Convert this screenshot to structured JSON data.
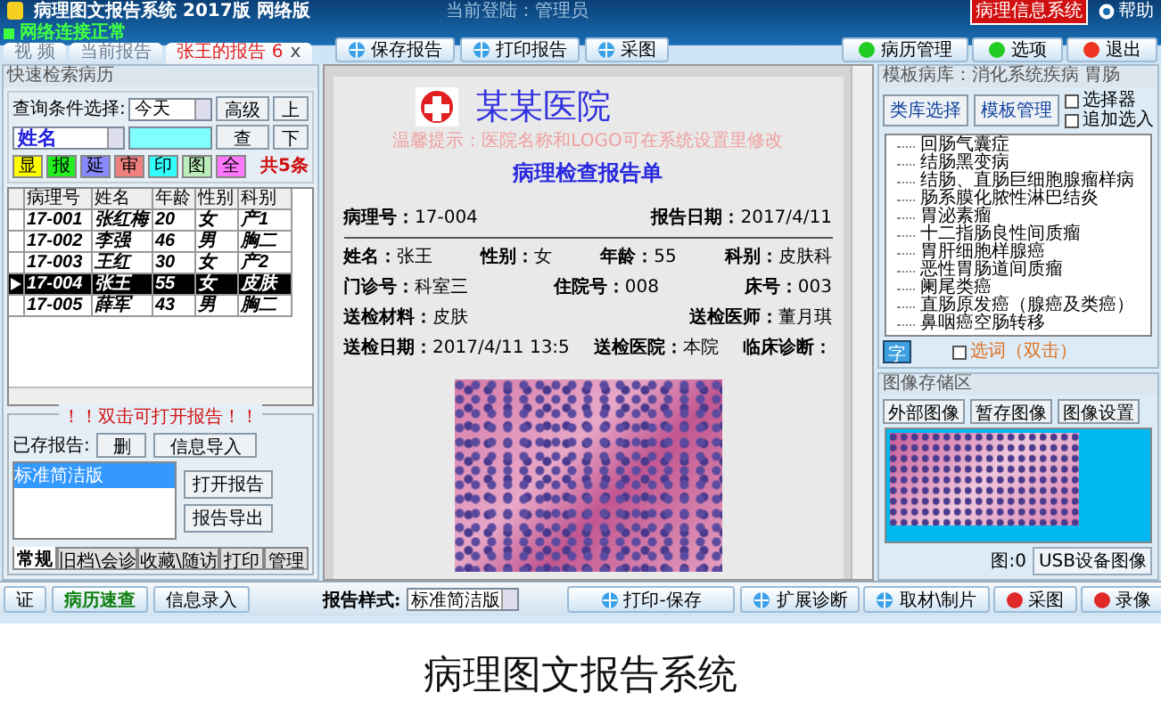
{
  "title_bar": {
    "title": "病理图文报告系统 2017版 网络版",
    "login": "当前登陆：管理员",
    "badge": "病理信息系统",
    "help": "帮助"
  },
  "connection": "网络连接正常",
  "report_tabs": [
    {
      "label": "视 频",
      "selected": false
    },
    {
      "label": "当前报告",
      "selected": false
    },
    {
      "label": "张王的报告 6",
      "selected": true,
      "close": "x"
    }
  ],
  "toolbar": [
    "保存报告",
    "打印报告",
    "采图"
  ],
  "nav_buttons": [
    {
      "label": "病历管理",
      "color": "#22cc22"
    },
    {
      "label": "选项",
      "color": "#22cc22"
    },
    {
      "label": "退出",
      "color": "#ee3322"
    }
  ],
  "search_panel": {
    "title": "快速检索病历",
    "query_label": "查询条件选择:",
    "query_value": "今天",
    "buttons": [
      "高级",
      "上",
      "查",
      "下"
    ],
    "field_select": "姓名",
    "filters": [
      {
        "label": "显",
        "color": "#ffff00"
      },
      {
        "label": "报",
        "color": "#22ee22"
      },
      {
        "label": "延",
        "color": "#8888ff"
      },
      {
        "label": "审",
        "color": "#f08080"
      },
      {
        "label": "印",
        "color": "#33ffff"
      },
      {
        "label": "图",
        "color": "#bbeebb"
      },
      {
        "label": "全",
        "color": "#ff77ff"
      }
    ],
    "count": "共5条",
    "table": {
      "columns": [
        "病理号",
        "姓名",
        "年龄",
        "性别",
        "科别"
      ],
      "rows": [
        {
          "cells": [
            "17-001",
            "张红梅",
            "20",
            "女",
            "产1"
          ],
          "selected": false
        },
        {
          "cells": [
            "17-002",
            "李强",
            "46",
            "男",
            "胸二"
          ],
          "selected": false
        },
        {
          "cells": [
            "17-003",
            "王红",
            "30",
            "女",
            "产2"
          ],
          "selected": false
        },
        {
          "cells": [
            "17-004",
            "张王",
            "55",
            "女",
            "皮肤"
          ],
          "selected": true
        },
        {
          "cells": [
            "17-005",
            "薛军",
            "43",
            "男",
            "胸二"
          ],
          "selected": false
        }
      ]
    },
    "hint": "！！双击可打开报告！！",
    "saved_label": "已存报告:",
    "saved_buttons": [
      "删",
      "信息导入"
    ],
    "saved_list": [
      {
        "label": "标准简洁版",
        "selected": true
      }
    ],
    "report_buttons": [
      "打开报告",
      "报告导出"
    ],
    "tabs": [
      {
        "label": "常规",
        "selected": true
      },
      {
        "label": "旧档\\会诊",
        "selected": false
      },
      {
        "label": "收藏\\随访",
        "selected": false
      },
      {
        "label": "打印",
        "selected": false
      },
      {
        "label": "管理",
        "selected": false
      }
    ]
  },
  "report": {
    "hospital": "某某医院",
    "notice": "温馨提示：医院名称和LOGO可在系统设置里修改",
    "title": "病理检查报告单",
    "head_fields": [
      {
        "label": "病理号：",
        "value": "17-004"
      },
      {
        "label": "报告日期：",
        "value": "2017/4/11"
      }
    ],
    "field_rows": [
      [
        {
          "label": "姓名：",
          "value": "张王"
        },
        {
          "label": "性别：",
          "value": "女"
        },
        {
          "label": "年龄：",
          "value": "55"
        },
        {
          "label": "科别：",
          "value": "皮肤科"
        }
      ],
      [
        {
          "label": "门诊号：",
          "value": "科室三"
        },
        {
          "label": "住院号：",
          "value": "008"
        },
        {
          "label": "床号：",
          "value": "003"
        }
      ],
      [
        {
          "label": "送检材料：",
          "value": "皮肤"
        },
        {
          "label": "送检医师：",
          "value": "董月琪"
        }
      ],
      [
        {
          "label": "送检日期：",
          "value": "2017/4/11 13:5"
        },
        {
          "label": "送检医院：",
          "value": "本院"
        },
        {
          "label": "临床诊断："
        }
      ]
    ]
  },
  "template_panel": {
    "title": "模板病库：消化系统疾病 胃肠",
    "buttons": [
      "类库选择",
      "模板管理"
    ],
    "options": [
      {
        "label": "选择器",
        "checked": false
      },
      {
        "label": "追加选入",
        "checked": false
      }
    ],
    "items": [
      "回肠气囊症",
      "结肠黑变病",
      "结肠、直肠巨细胞腺瘤样病",
      "肠系膜化脓性淋巴结炎",
      "胃泌素瘤",
      "十二指肠良性间质瘤",
      "胃肝细胞样腺癌",
      "恶性胃肠道间质瘤",
      "阑尾类癌",
      "直肠原发癌（腺癌及类癌）",
      "鼻咽癌空肠转移"
    ],
    "char_button": "字",
    "word_option": {
      "label": "选词（双击）",
      "checked": false
    }
  },
  "image_panel": {
    "title": "图像存储区",
    "buttons": [
      "外部图像",
      "暂存图像",
      "图像设置"
    ],
    "count": "图:0",
    "usb": "USB设备图像"
  },
  "bottom_bar": {
    "left_buttons": [
      "证",
      "病历速查",
      "信息录入"
    ],
    "style_label": "报告样式:",
    "style_value": "标准简洁版",
    "print": "打印-保存",
    "right_buttons": [
      {
        "label": "扩展诊断",
        "kind": "globe"
      },
      {
        "label": "取材\\制片",
        "kind": "globe"
      },
      {
        "label": "采图",
        "kind": "record"
      },
      {
        "label": "录像",
        "kind": "record"
      }
    ]
  },
  "caption": "病理图文报告系统"
}
